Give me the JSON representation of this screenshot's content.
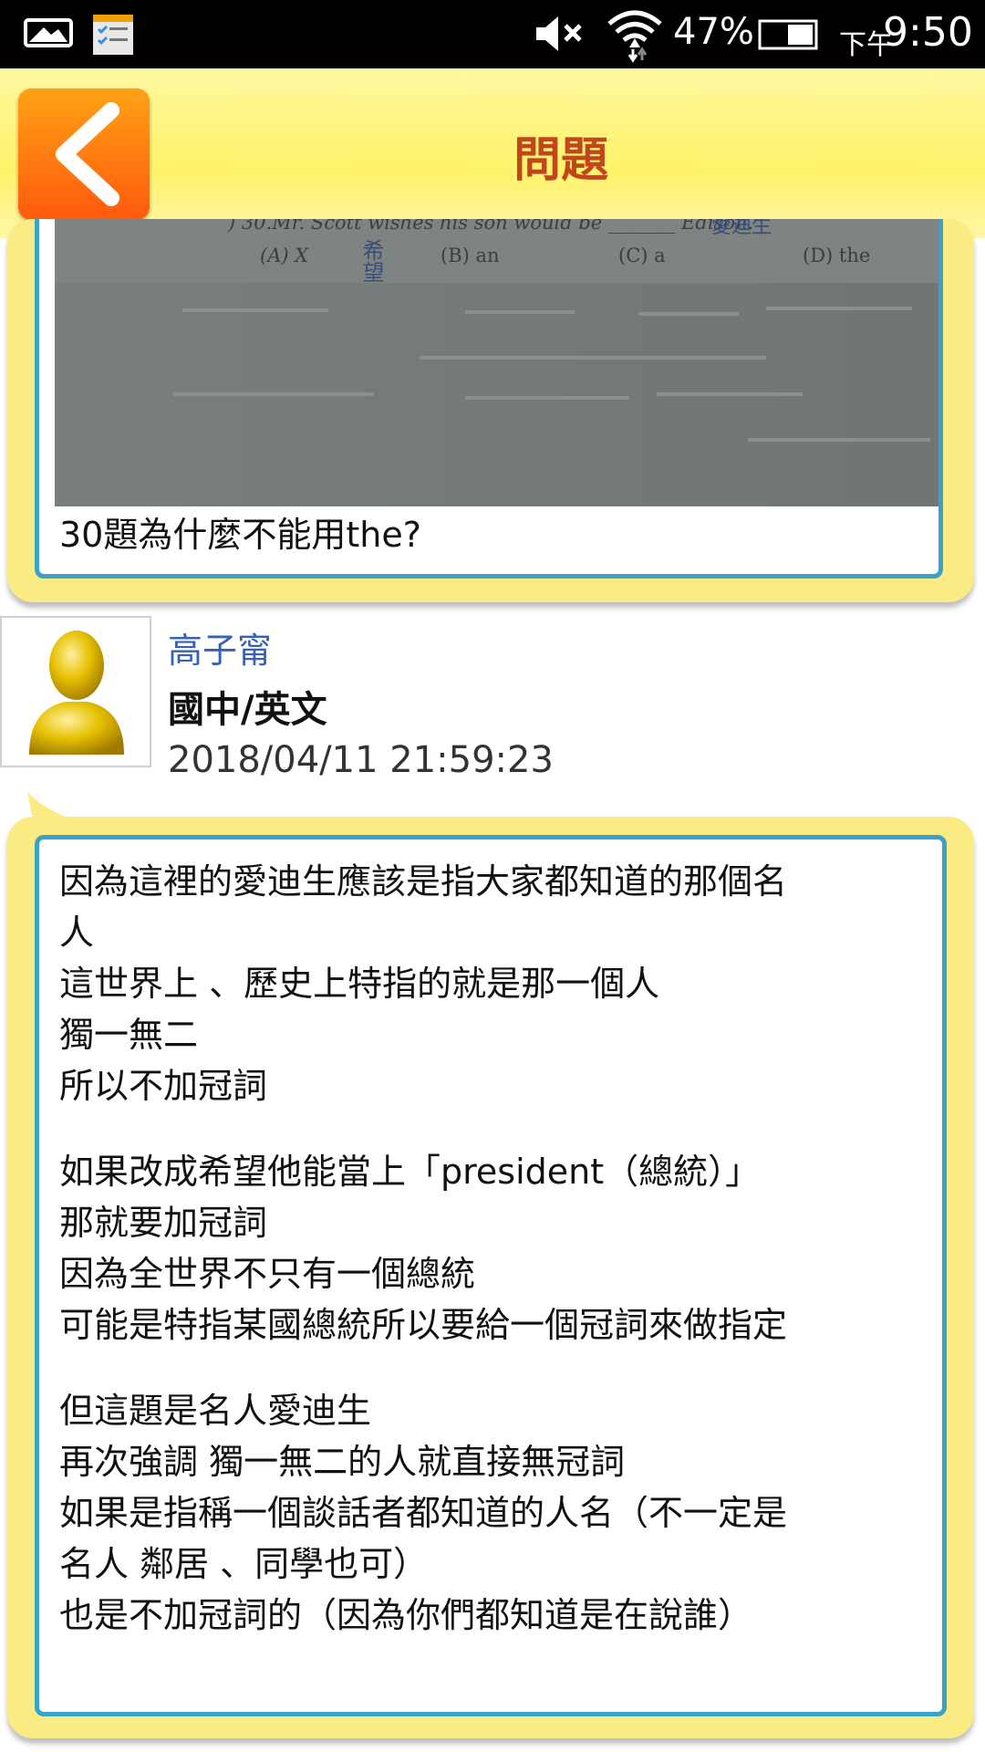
{
  "status_bar": {
    "battery": "47%",
    "time_prefix": "下午",
    "time": "9:50"
  },
  "header": {
    "title": "問題"
  },
  "question": {
    "photo_text": {
      "line": ") 30.Mr. Scott wishes his son would be _______ Edison.",
      "handwriting_top": "愛迪生",
      "handwriting_mid": "希望",
      "opt_a": "(A) X",
      "opt_b": "(B) an",
      "opt_c": "(C) a",
      "opt_d": "(D) the"
    },
    "text": "30題為什麼不能用the?"
  },
  "answerer": {
    "name": "高子甯",
    "subject": "國中/英文",
    "timestamp": "2018/04/11 21:59:23"
  },
  "answer": {
    "lines": [
      "因為這裡的愛迪生應該是指大家都知道的那個名",
      "人",
      "這世界上 、歷史上特指的就是那一個人",
      "獨一無二",
      "所以不加冠詞",
      "",
      "如果改成希望他能當上「president（總統）」",
      "那就要加冠詞",
      "因為全世界不只有一個總統",
      "可能是特指某國總統所以要給一個冠詞來做指定",
      "",
      "但這題是名人愛迪生",
      "再次強調 獨一無二的人就直接無冠詞",
      "如果是指稱一個談話者都知道的人名（不一定是",
      "名人 鄰居 、同學也可）",
      "也是不加冠詞的（因為你們都知道是在說誰）"
    ]
  },
  "icons": [
    "photo-icon",
    "checklist-icon",
    "mute-icon",
    "wifi-icon",
    "battery-icon",
    "back-arrow-icon",
    "avatar-icon"
  ]
}
